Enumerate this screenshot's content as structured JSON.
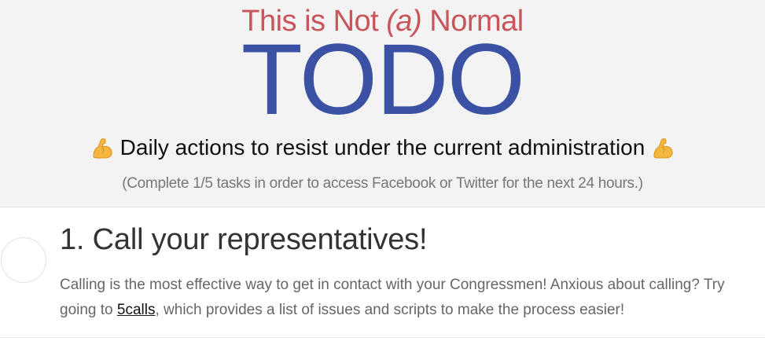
{
  "header": {
    "tagline_prefix": "This is Not ",
    "tagline_paren": "(a)",
    "tagline_suffix": " Normal",
    "title": "TODO",
    "subtitle": "Daily actions to resist under the current administration",
    "note": "(Complete 1/5 tasks in order to access Facebook or Twitter for the next 24 hours.)",
    "icon": "flexed-biceps-icon",
    "colors": {
      "tagline": "#c9555b",
      "title": "#3b52a4",
      "background": "#f3f3f3"
    }
  },
  "tasks": [
    {
      "title": "1. Call your representatives!",
      "desc_before": "Calling is the most effective way to get in contact with your Congressmen! Anxious about calling? Try going to ",
      "link_text": "5calls",
      "desc_after": ", which provides a list of issues and scripts to make the process easier!",
      "completed": false
    }
  ]
}
